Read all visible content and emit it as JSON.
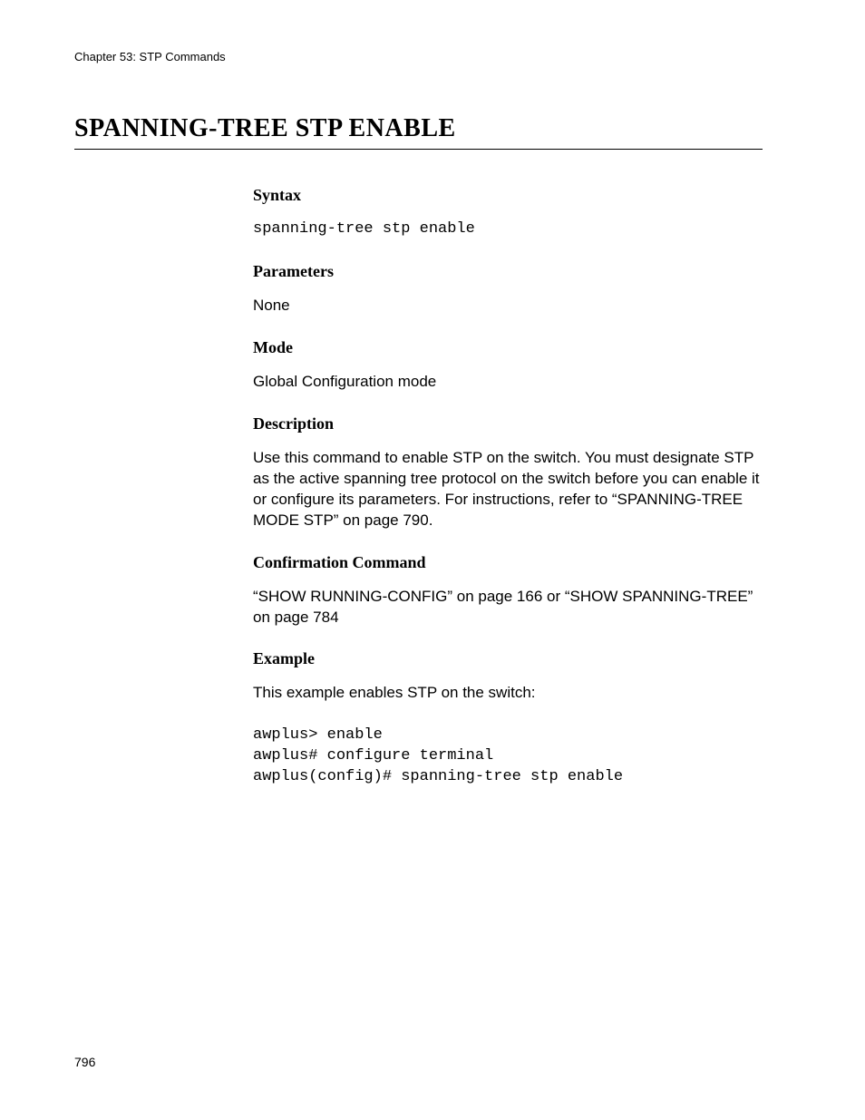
{
  "header": {
    "chapter": "Chapter 53: STP Commands"
  },
  "title": "SPANNING-TREE STP ENABLE",
  "sections": {
    "syntax": {
      "heading": "Syntax",
      "code": "spanning-tree stp enable"
    },
    "parameters": {
      "heading": "Parameters",
      "text": "None"
    },
    "mode": {
      "heading": "Mode",
      "text": "Global Configuration mode"
    },
    "description": {
      "heading": "Description",
      "text": "Use this command to enable STP on the switch. You must designate STP as the active spanning tree protocol on the switch before you can enable it or configure its parameters. For instructions, refer to “SPANNING-TREE MODE STP” on page 790."
    },
    "confirmation": {
      "heading": "Confirmation Command",
      "text": "“SHOW RUNNING-CONFIG” on page 166 or “SHOW SPANNING-TREE” on page 784"
    },
    "example": {
      "heading": "Example",
      "text": "This example enables STP on the switch:",
      "code": "awplus> enable\nawplus# configure terminal\nawplus(config)# spanning-tree stp enable"
    }
  },
  "pageNumber": "796"
}
